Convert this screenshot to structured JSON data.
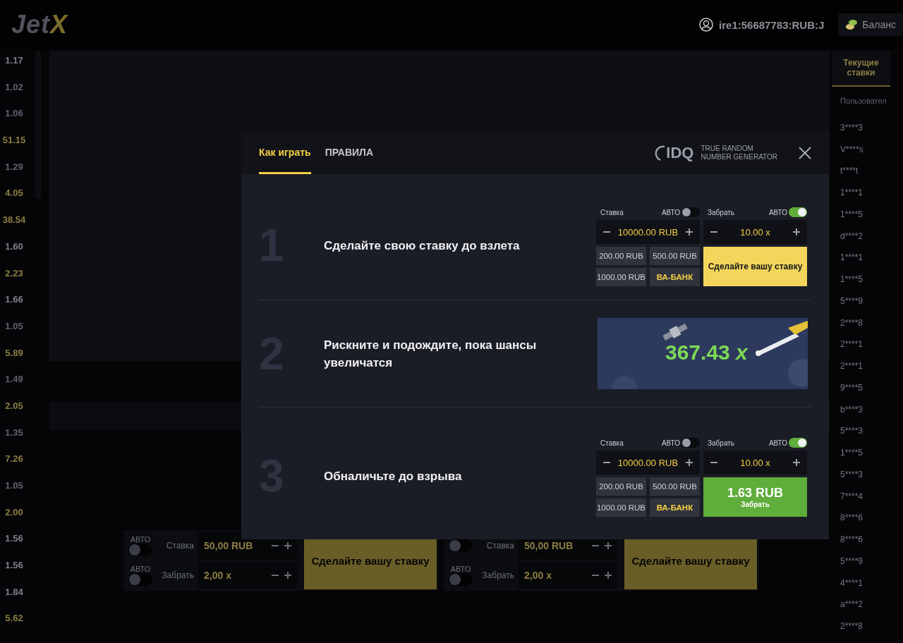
{
  "header": {
    "logo": {
      "text": "Jet",
      "accent": "X"
    },
    "user_id": "ire1:56687783:RUB:J",
    "balance_button": "Баланс"
  },
  "history": [
    {
      "value": "1.17",
      "color": "#7c808a"
    },
    {
      "value": "1.02",
      "color": "#5e626e"
    },
    {
      "value": "1.06",
      "color": "#5e626e"
    },
    {
      "value": "51.15",
      "color": "#8c7e44"
    },
    {
      "value": "1.29",
      "color": "#5e626e"
    },
    {
      "value": "4.05",
      "color": "#8c7e44"
    },
    {
      "value": "38.54",
      "color": "#8c7e44"
    },
    {
      "value": "1.60",
      "color": "#7c808a"
    },
    {
      "value": "2.23",
      "color": "#8c7e44"
    },
    {
      "value": "1.66",
      "color": "#7c808a"
    },
    {
      "value": "1.05",
      "color": "#5e626e"
    },
    {
      "value": "5.89",
      "color": "#8c7e44"
    },
    {
      "value": "1.49",
      "color": "#5e626e"
    },
    {
      "value": "2.05",
      "color": "#8c7e44"
    },
    {
      "value": "1.35",
      "color": "#5e626e"
    },
    {
      "value": "7.26",
      "color": "#8c7e44"
    },
    {
      "value": "1.05",
      "color": "#5e626e"
    },
    {
      "value": "2.00",
      "color": "#8c7e44"
    },
    {
      "value": "1.56",
      "color": "#7c808a"
    },
    {
      "value": "1.56",
      "color": "#7c808a"
    },
    {
      "value": "1.84",
      "color": "#7c808a"
    },
    {
      "value": "5.62",
      "color": "#8c7e44"
    }
  ],
  "bet_panels": [
    {
      "rows": [
        {
          "auto_label": "АВТО",
          "auto_on": false,
          "label": "Ставка",
          "value": "50,00 RUB"
        },
        {
          "auto_label": "АВТО",
          "auto_on": false,
          "label": "Забрать",
          "value": "2,00 x"
        }
      ],
      "button": "Сделайте вашу ставку"
    },
    {
      "rows": [
        {
          "auto_on": false,
          "label": "Ставка",
          "value": "50,00 RUB"
        },
        {
          "auto_label": "АВТО",
          "auto_on": false,
          "label": "Забрать",
          "value": "2,00 x"
        }
      ],
      "button": "Сделайте вашу ставку"
    }
  ],
  "sidebar": {
    "tabs": [
      {
        "label": "Текущие ставки",
        "selected": true
      }
    ],
    "column_header": "Пользовател",
    "users": [
      "3****3",
      "V****s",
      "t****t",
      "1****1",
      "1****5",
      "d****2",
      "1****1",
      "1****5",
      "5****9",
      "2****8",
      "2****1",
      "2****1",
      "9****5",
      "b****3",
      "5****3",
      "1****5",
      "5****3",
      "7****4",
      "8****6",
      "8****6",
      "5****9",
      "4****1",
      "a****2",
      "2****8"
    ]
  },
  "modal": {
    "tabs": [
      {
        "label": "Как играть",
        "selected": true
      },
      {
        "label": "ПРАВИЛА",
        "selected": false
      }
    ],
    "provider": {
      "logo": "IDQ",
      "line1": "TRUE RANDOM",
      "line2": "NUMBER GENERATOR"
    },
    "steps": [
      {
        "number": "1",
        "text": "Сделайте свою ставку до взлета",
        "widget": {
          "kind": "bet_panel",
          "left": {
            "label": "Ставка",
            "auto_label": "АВТО",
            "auto_on": false,
            "value": "10000.00 RUB"
          },
          "right": {
            "label": "Забрать",
            "auto_label": "АВТО",
            "auto_on": true,
            "value": "10.00 x"
          },
          "quick": [
            "200.00 RUB",
            "500.00 RUB",
            "1000.00 RUB"
          ],
          "all_in": "ВА-БАНК",
          "action": {
            "kind": "bet",
            "label": "Сделайте вашу ставку"
          }
        }
      },
      {
        "number": "2",
        "text": "Рискните и подождите, пока шансы увеличатся",
        "widget": {
          "kind": "game_frame",
          "multiplier": "367.43 *x*"
        }
      },
      {
        "number": "3",
        "text": "Обналичьте до взрыва",
        "widget": {
          "kind": "bet_panel",
          "left": {
            "label": "Ставка",
            "auto_label": "АВТО",
            "auto_on": false,
            "value": "10000.00 RUB"
          },
          "right": {
            "label": "Забрать",
            "auto_label": "АВТО",
            "auto_on": true,
            "value": "10.00 x"
          },
          "quick": [
            "200.00 RUB",
            "500.00 RUB",
            "1000.00 RUB"
          ],
          "all_in": "ВА-БАНК",
          "action": {
            "kind": "cashout",
            "amount": "1.63 RUB",
            "label": "Забрать"
          }
        }
      }
    ]
  }
}
